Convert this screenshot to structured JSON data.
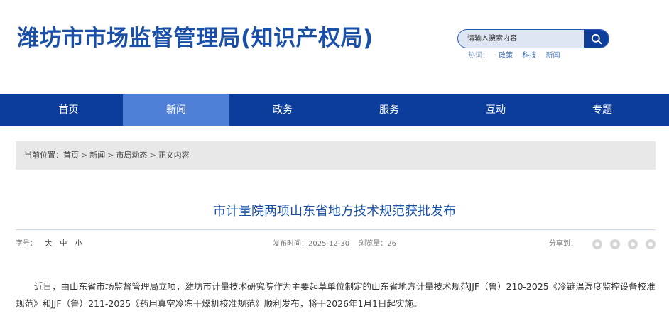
{
  "header": {
    "site_title": "潍坊市市场监督管理局(知识产权局)",
    "search": {
      "placeholder": "请输入搜索内容",
      "button_icon": "search-icon"
    },
    "hotwords": {
      "label": "热词：",
      "items": [
        "政策",
        "科技",
        "新闻"
      ]
    }
  },
  "nav": {
    "items": [
      {
        "label": "首页"
      },
      {
        "label": "新闻"
      },
      {
        "label": "政务"
      },
      {
        "label": "服务"
      },
      {
        "label": "互动"
      },
      {
        "label": "专题"
      }
    ],
    "active_index": 1
  },
  "breadcrumb": {
    "prefix": "当前位置：",
    "items": [
      "首页",
      "新闻",
      "市局动态",
      "正文内容"
    ],
    "separator": ">"
  },
  "article": {
    "title": "市计量院两项山东省地方技术规范获批发布",
    "font_size": {
      "label": "字号：",
      "options": [
        "大",
        "中",
        "小"
      ]
    },
    "publish_time": "发布时间：2025-12-30",
    "views": "浏览量：26",
    "share_label": "分享到：",
    "share_icons": [
      "wechat-icon",
      "weibo-icon",
      "qq-icon",
      "qzone-icon"
    ],
    "body": "近日，由山东省市场监督管理局立项，潍坊市计量技术研究院作为主要起草单位制定的山东省地方计量技术规范JJF（鲁）210-2025《冷链温湿度监控设备校准规范》和JJF（鲁）211-2025《药用真空冷冻干燥机校准规范》顺利发布，将于2026年1月1日起实施。"
  },
  "colors": {
    "brand_blue": "#1a4fa8",
    "nav_bg": "#0c3d9c",
    "nav_active": "#4f7fd6",
    "breadcrumb_bg": "#e8e8e8"
  }
}
